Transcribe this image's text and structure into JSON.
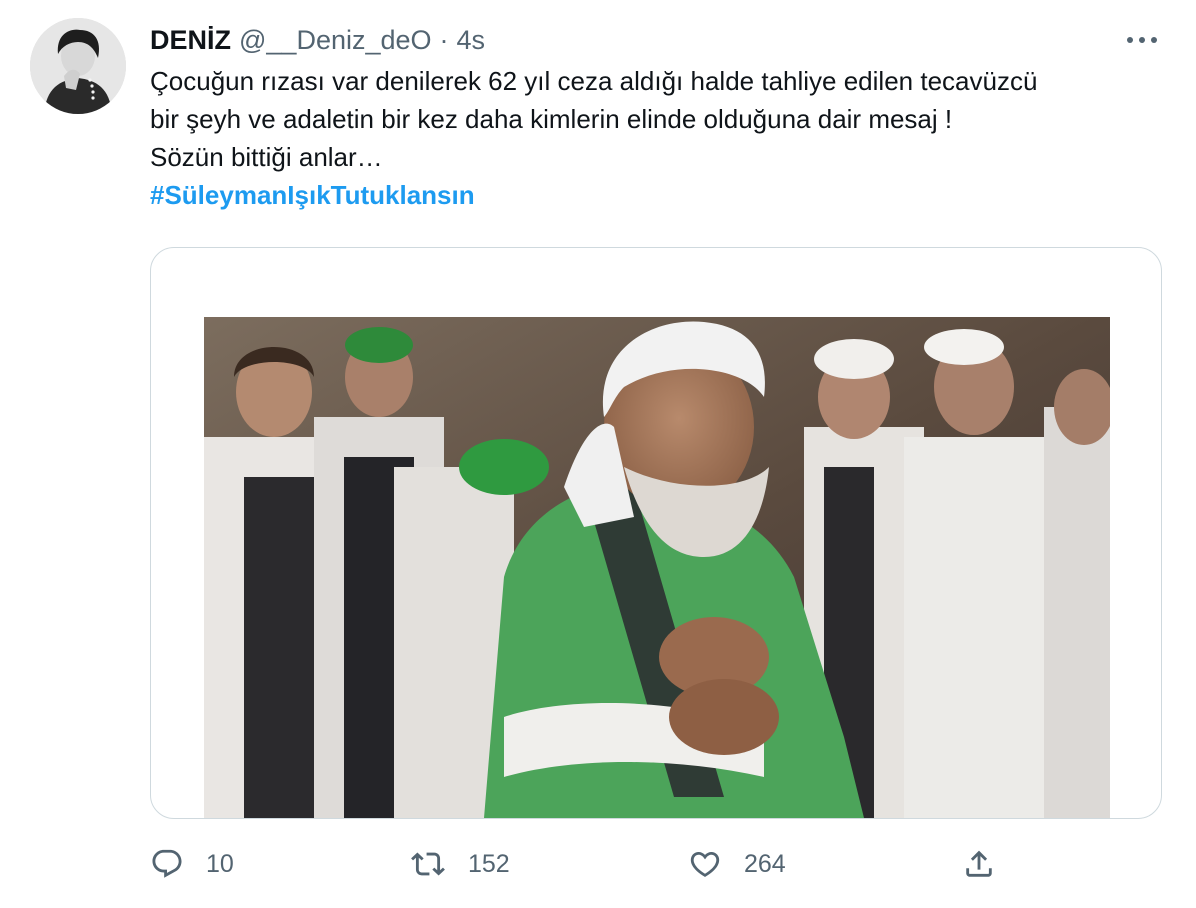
{
  "tweet": {
    "display_name": "DENİZ",
    "handle": "@__Deniz_deO",
    "separator": "·",
    "time": "4s",
    "text_lines": [
      "Çocuğun rızası var denilerek 62 yıl ceza aldığı halde tahliye edilen tecavüzcü",
      "bir şeyh  ve adaletin bir kez daha kimlerin elinde olduğuna dair mesaj !",
      "Sözün bittiği anlar…"
    ],
    "hashtag": "#SüleymanIşıkTutuklansın"
  },
  "actions": {
    "reply": {
      "icon": "reply-icon",
      "count": "10"
    },
    "retweet": {
      "icon": "retweet-icon",
      "count": "152"
    },
    "like": {
      "icon": "heart-icon",
      "count": "264"
    },
    "share": {
      "icon": "share-icon"
    }
  },
  "colors": {
    "accent": "#1d9bf0",
    "secondary_text": "#536471",
    "border": "#cfd9de"
  }
}
